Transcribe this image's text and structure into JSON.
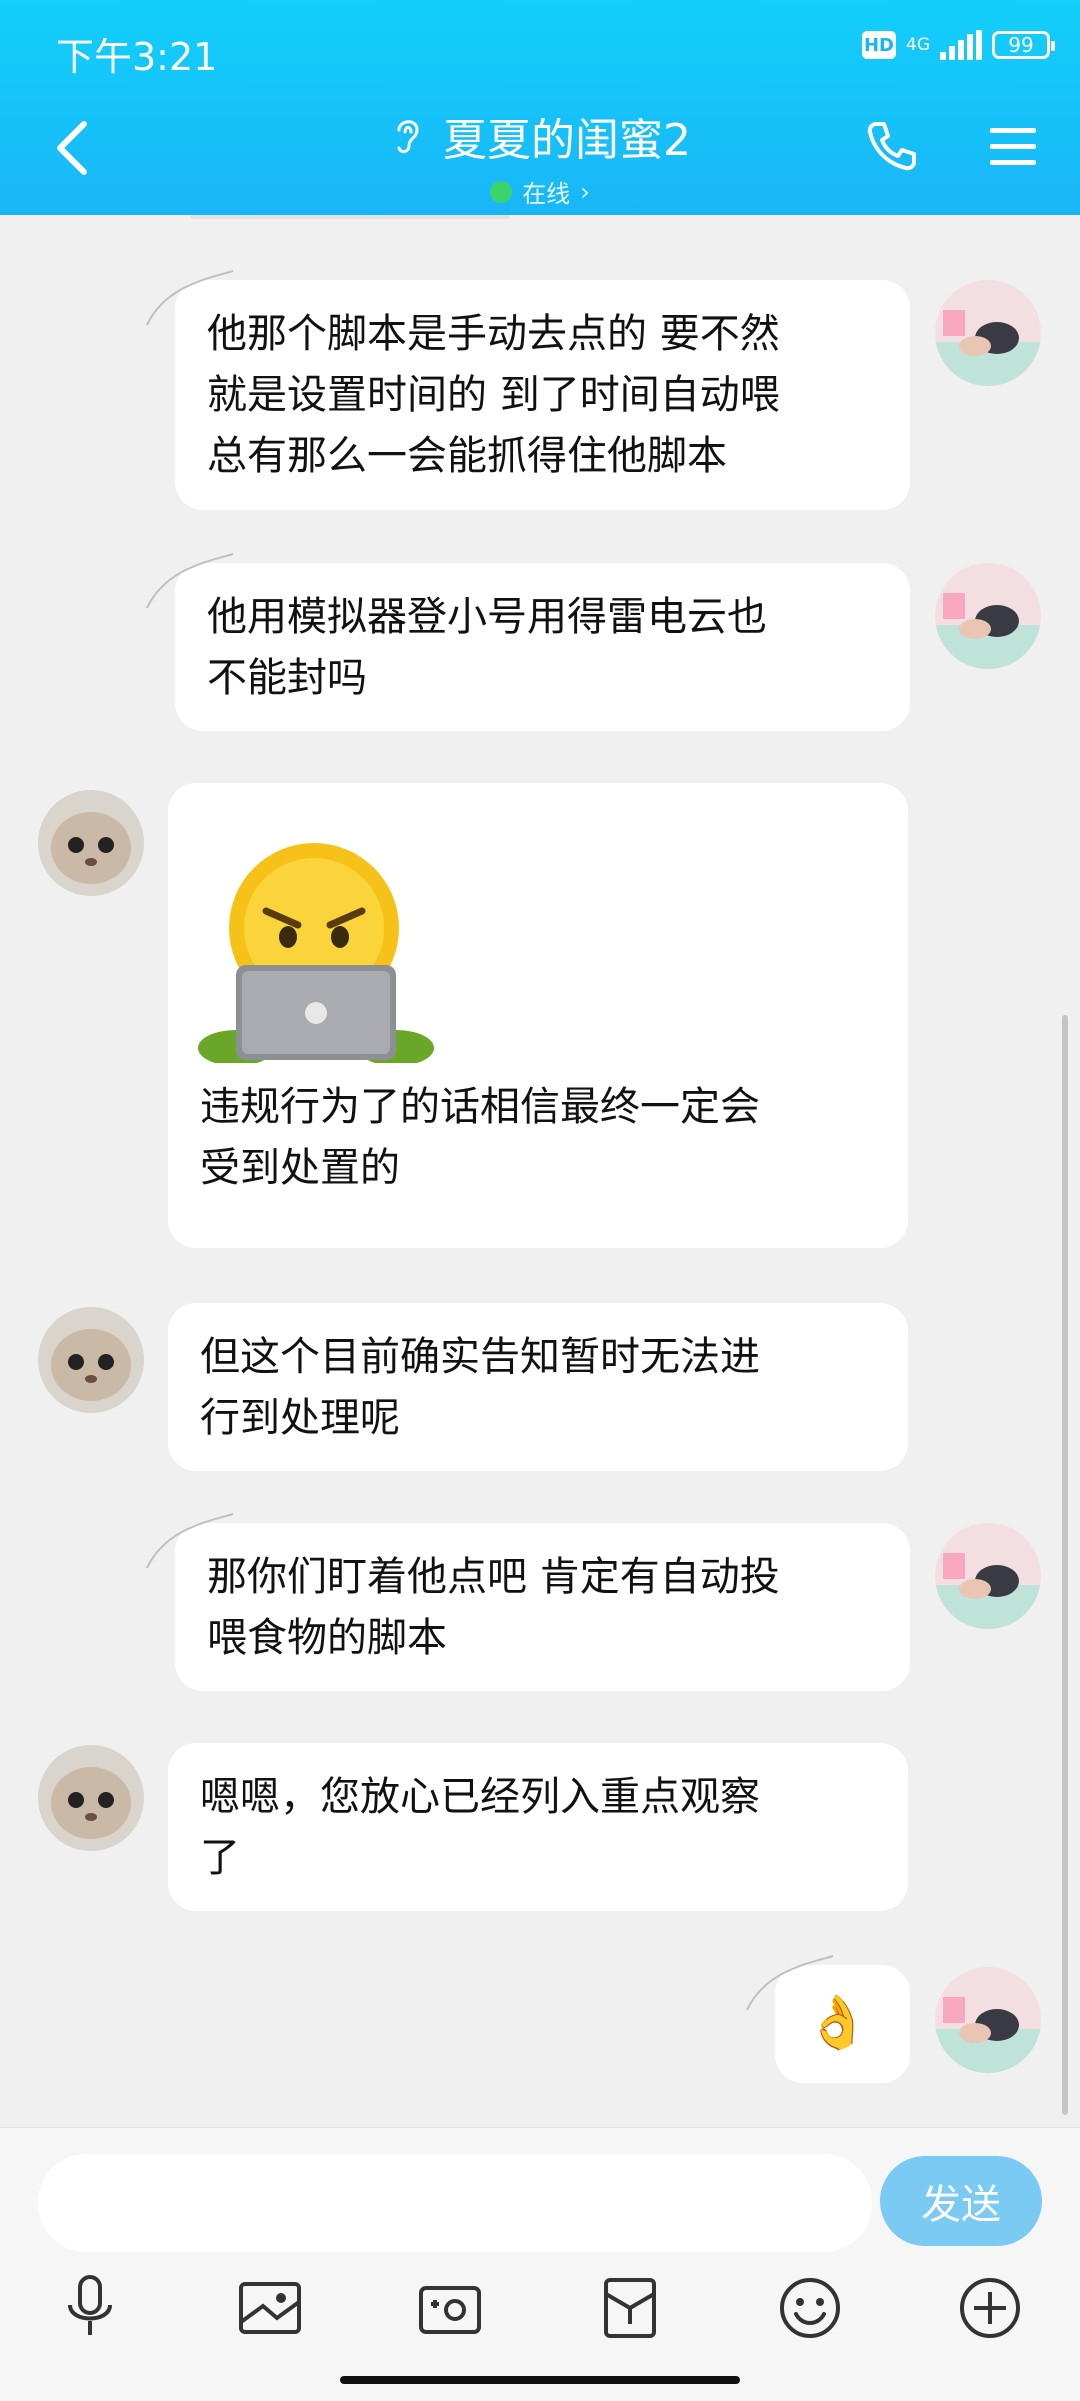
{
  "status": {
    "time": "下午3:21",
    "network": "4G",
    "battery": "99",
    "hd": "HD"
  },
  "header": {
    "title": "夏夏的闺蜜2",
    "presence": "在线"
  },
  "messages": [
    {
      "side": "right",
      "text": "他那个脚本是手动去点的 要不然就是设置时间的 到了时间自动喂总有那么一会能抓得住他脚本",
      "lines": [
        "他那个脚本是手动去点的 要不然",
        "就是设置时间的 到了时间自动喂",
        "总有那么一会能抓得住他脚本"
      ]
    },
    {
      "side": "right",
      "text": "他用模拟器登小号用得雷电云也不能封吗",
      "lines": [
        "他用模拟器登小号用得雷电云也",
        "不能封吗"
      ]
    },
    {
      "side": "left",
      "sticker": "angry-laptop-emoji",
      "lines": [
        "违规行为了的话相信最终一定会",
        "受到处置的"
      ]
    },
    {
      "side": "left",
      "lines": [
        "但这个目前确实告知暂时无法进",
        "行到处理呢"
      ]
    },
    {
      "side": "right",
      "lines": [
        "那你们盯着他点吧 肯定有自动投",
        "喂食物的脚本"
      ]
    },
    {
      "side": "left",
      "lines": [
        "嗯嗯，您放心已经列入重点观察",
        "了"
      ]
    },
    {
      "side": "right",
      "lines": [
        "👌"
      ]
    }
  ],
  "input": {
    "placeholder": "",
    "send_label": "发送"
  },
  "toolbar": [
    "microphone-icon",
    "image-icon",
    "camera-icon",
    "red-packet-icon",
    "emoji-icon",
    "plus-icon"
  ],
  "colors": {
    "header": "#19b6f7",
    "send": "#7bcaf4",
    "online": "#3ad46a"
  }
}
